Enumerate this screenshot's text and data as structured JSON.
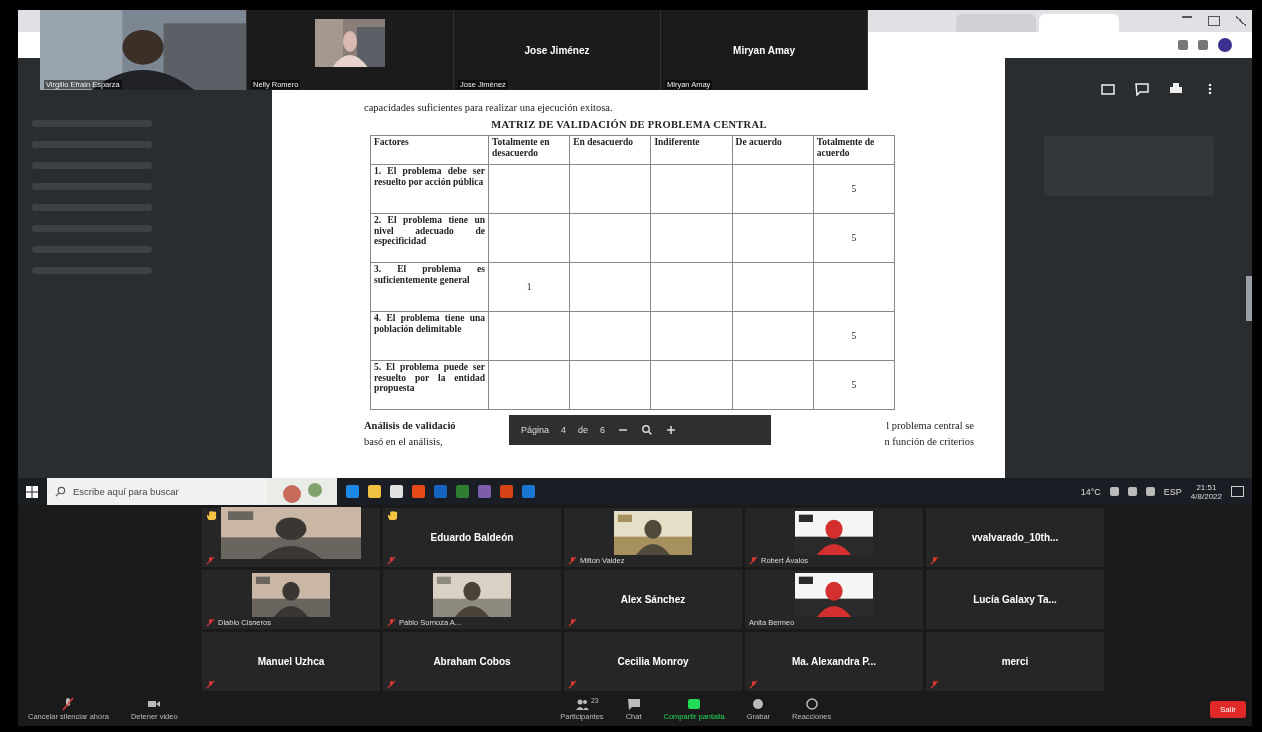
{
  "video_strip": [
    {
      "name": "Virgilio Efrain Esparza",
      "kind": "video"
    },
    {
      "name": "Nelly Romero",
      "kind": "video"
    },
    {
      "name": "Jose Jiménez",
      "kind": "name",
      "center_name": "Jose Jiménez"
    },
    {
      "name": "Miryan Amay",
      "kind": "name",
      "center_name": "Miryan Amay"
    }
  ],
  "document": {
    "intro": "capacidades suficientes para realizar una ejecución exitosa.",
    "title": "MATRIZ DE VALIDACIÓN DE PROBLEMA CENTRAL",
    "columns": [
      "Factores",
      "Totalmente en desacuerdo",
      "En desacuerdo",
      "Indiferente",
      "De acuerdo",
      "Totalmente de acuerdo"
    ],
    "rows": [
      {
        "factor": "1. El problema debe ser resuelto por acción pública",
        "mark": "5",
        "kind": "strongly_agree"
      },
      {
        "factor": "2. El problema tiene un nivel adecuado de especificidad",
        "mark": "5",
        "kind": "strongly_agree"
      },
      {
        "factor": "3. El problema es suficientemente general",
        "mark": "1",
        "kind": "strongly_disagree"
      },
      {
        "factor": "4. El problema tiene una población delimitable",
        "mark": "5",
        "kind": "strongly_agree"
      },
      {
        "factor": "5. El problema puede ser resuelto por la entidad propuesta",
        "mark": "5",
        "kind": "strongly_agree"
      }
    ],
    "para_lines": [
      {
        "left": "Análisis de validació",
        "right": "l problema central se"
      },
      {
        "left": "basó en el análisis,",
        "right": "n función de criterios"
      }
    ],
    "page_toolbar": {
      "label": "Página",
      "page": "4",
      "separator": "de",
      "total": "6"
    }
  },
  "taskbar": {
    "search_placeholder": "Escribe aquí para buscar",
    "temperature": "14°C",
    "language": "ESP",
    "time": "21:51",
    "date": "4/8/2022"
  },
  "gallery": [
    {
      "kind": "video",
      "hand_raised": true,
      "muted": true
    },
    {
      "kind": "name",
      "center_name": "Eduardo Baldeón",
      "hand_raised": true,
      "muted": true
    },
    {
      "kind": "video",
      "name": "Milton Valdez",
      "hand_raised": false,
      "muted": true
    },
    {
      "name": "Robert Ávalos",
      "hand_raised": false,
      "muted": true
    },
    {
      "kind": "name",
      "center_name": "vvalvarado_10th...",
      "hand_raised": false,
      "muted": true
    },
    {
      "name": "Diablo Cisneros",
      "hand_raised": false,
      "muted": true
    },
    {
      "name": "Pablo Sornoza A...",
      "hand_raised": false,
      "muted": true
    },
    {
      "kind": "name",
      "center_name": "Alex Sánchez",
      "hand_raised": false,
      "muted": true
    },
    {
      "kind": "video",
      "name": "Anita Bermeo",
      "hand_raised": false,
      "muted": false
    },
    {
      "kind": "name",
      "center_name": "Lucía Galaxy Ta...",
      "hand_raised": false,
      "muted": false
    },
    {
      "kind": "name",
      "center_name": "Manuel Uzhca",
      "hand_raised": false,
      "muted": true
    },
    {
      "kind": "name",
      "center_name": "Abraham Cobos",
      "hand_raised": false,
      "muted": true
    },
    {
      "kind": "name",
      "center_name": "Cecilia Monroy",
      "hand_raised": false,
      "muted": true
    },
    {
      "kind": "name",
      "center_name": "Ma. Alexandra P...",
      "hand_raised": false,
      "muted": true
    },
    {
      "kind": "name",
      "center_name": "merci",
      "hand_raised": false,
      "muted": true
    }
  ],
  "meeting_toolbar": {
    "audio": "Cancelar silenciar ahora",
    "video": "Detener video",
    "participants": "Participantes",
    "participant_count": "23",
    "chat": "Chat",
    "share": "Compartir pantalla",
    "record": "Grabar",
    "reactions": "Reacciones",
    "leave": "Salir"
  }
}
